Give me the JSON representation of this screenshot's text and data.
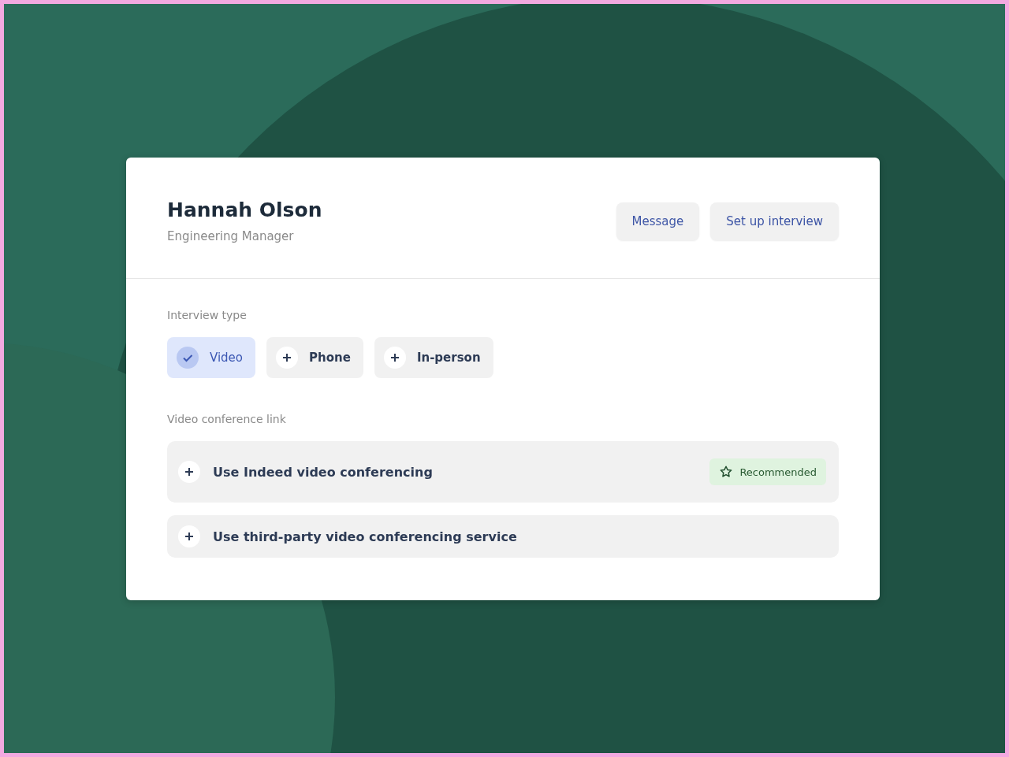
{
  "candidate": {
    "name": "Hannah Olson",
    "title": "Engineering Manager"
  },
  "actions": [
    "Message",
    "Set up interview"
  ],
  "interview_type": {
    "label": "Interview type",
    "options": [
      {
        "label": "Video",
        "selected": true
      },
      {
        "label": "Phone",
        "selected": false
      },
      {
        "label": "In-person",
        "selected": false
      }
    ]
  },
  "conference_link": {
    "label": "Video conference link",
    "options": [
      {
        "label": "Use Indeed video conferencing",
        "badge": "Recommended"
      },
      {
        "label": "Use third-party video conferencing service"
      }
    ]
  }
}
